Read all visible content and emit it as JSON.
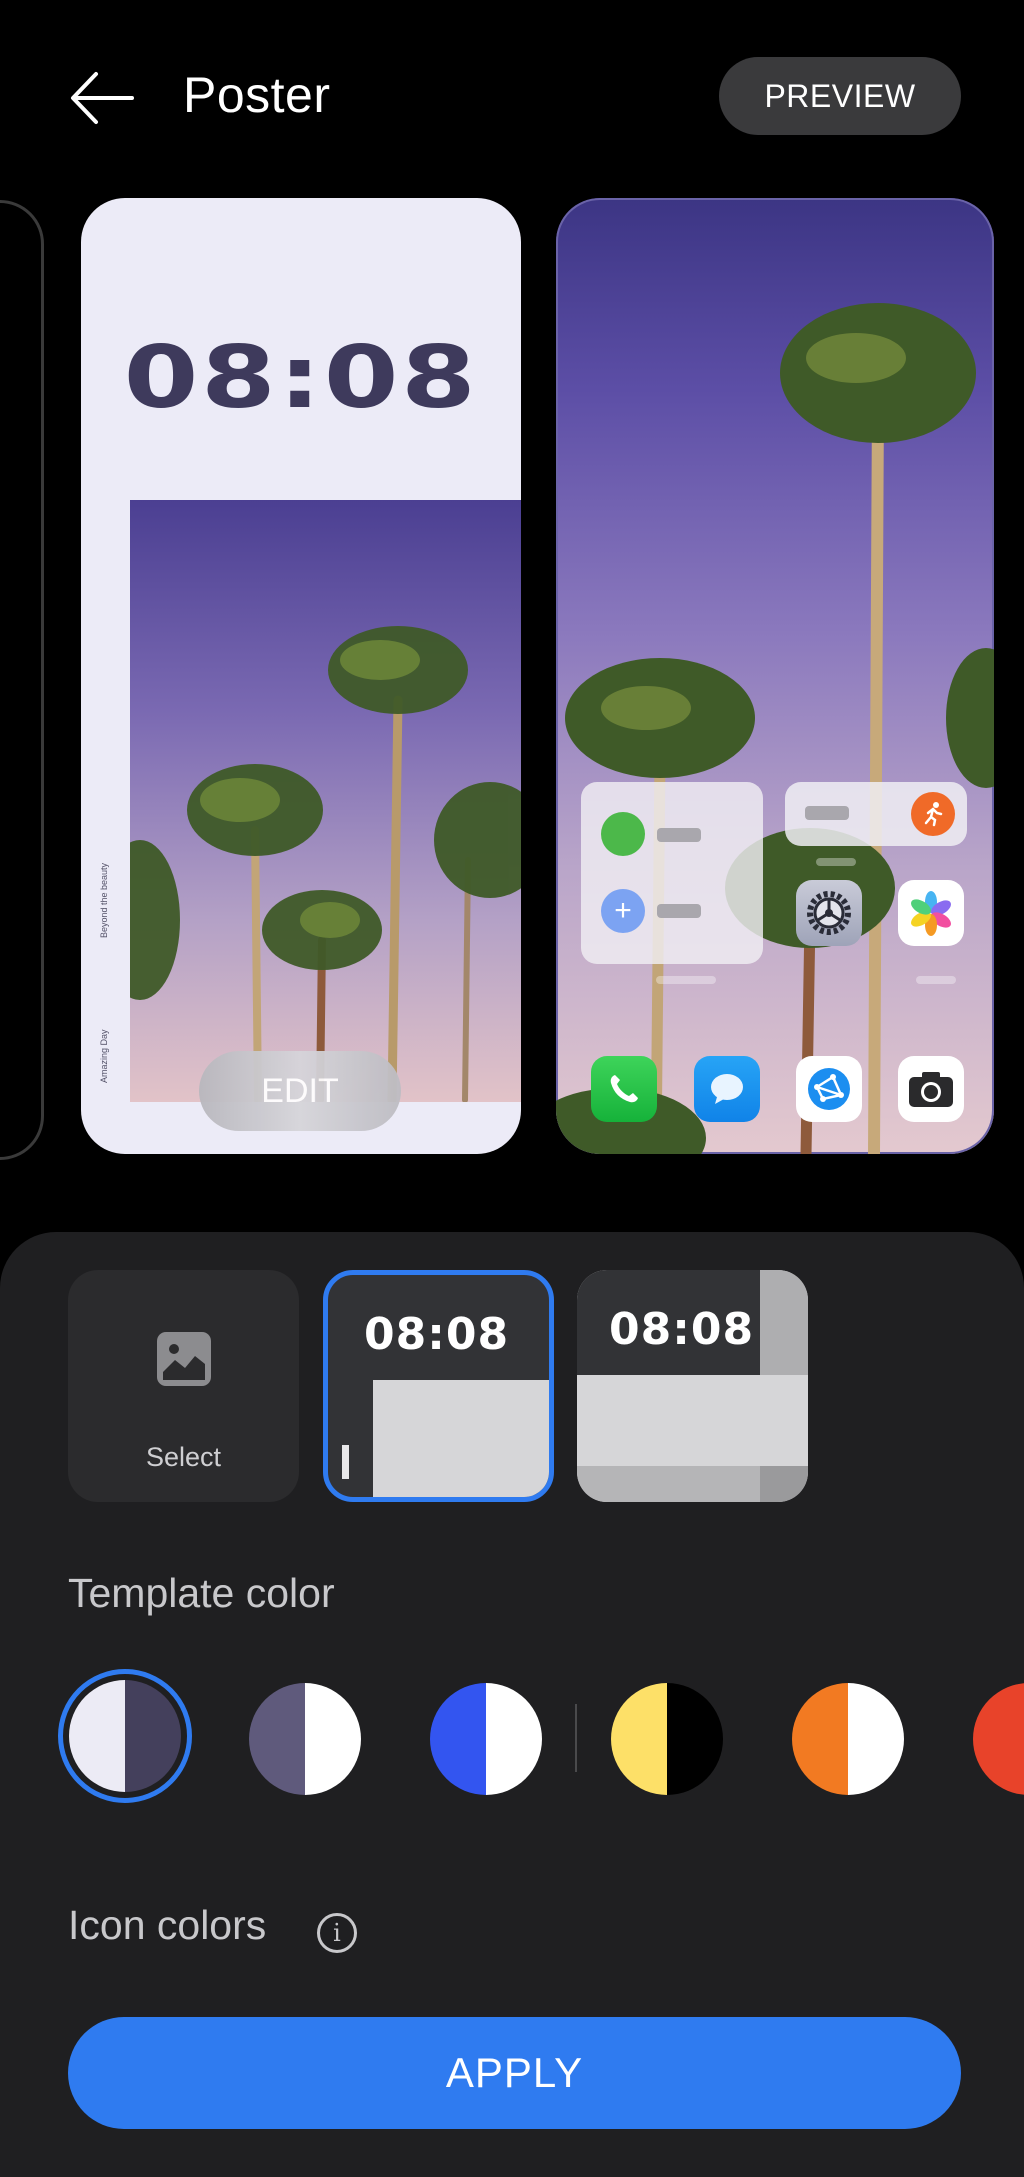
{
  "header": {
    "back_icon": "arrow-left-icon",
    "title": "Poster",
    "preview_label": "PREVIEW"
  },
  "carousel": {
    "poster_card": {
      "time": "08:08",
      "caption_top": "Beyond the beauty",
      "caption_bottom": "Amazing Day",
      "edit_label": "EDIT",
      "background": "#ecebf7",
      "time_color": "#3e3a5c"
    },
    "home_card": {
      "widgets": [
        {
          "name": "contacts-widget",
          "items": [
            "green-dot",
            "add-contact-icon"
          ]
        },
        {
          "name": "health-widget",
          "icon": "running-icon"
        }
      ],
      "app_icons": [
        {
          "name": "settings-icon"
        },
        {
          "name": "gallery-icon"
        },
        {
          "name": "phone-icon"
        },
        {
          "name": "messages-icon"
        },
        {
          "name": "browser-icon"
        },
        {
          "name": "camera-icon"
        }
      ]
    }
  },
  "templates": {
    "select_label": "Select",
    "select_icon": "image-icon",
    "items": [
      {
        "time": "08:08",
        "selected": true
      },
      {
        "time": "08:08",
        "selected": false
      }
    ]
  },
  "template_color": {
    "label": "Template color",
    "swatches": [
      {
        "left": "#ecebf5",
        "right": "#44405c",
        "selected": true
      },
      {
        "left": "#5f5a7c",
        "right": "#ffffff",
        "selected": false
      },
      {
        "left": "#3355f0",
        "right": "#ffffff",
        "selected": false
      },
      {
        "left": "#fde068",
        "right": "#000000",
        "selected": false
      },
      {
        "left": "#f27a22",
        "right": "#ffffff",
        "selected": false
      },
      {
        "left": "#e8432a",
        "right": "#e8432a",
        "selected": false
      }
    ]
  },
  "icon_colors": {
    "label": "Icon colors",
    "info_icon": "info-icon",
    "info_glyph": "i"
  },
  "apply_label": "APPLY",
  "colors": {
    "accent": "#2f7bf0",
    "panel_bg": "#1f1f21",
    "page_bg": "#000000"
  }
}
